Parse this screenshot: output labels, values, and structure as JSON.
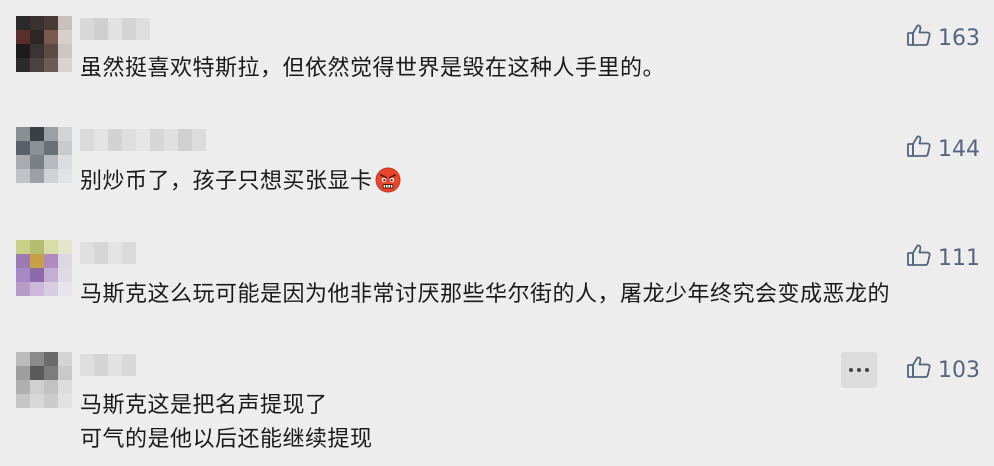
{
  "comments": [
    {
      "text_lines": [
        "虽然挺喜欢特斯拉，但依然觉得世界是毁在这种人手里的。"
      ],
      "likes": "163"
    },
    {
      "text_lines": [
        "别炒币了，孩子只想买张显卡"
      ],
      "emoji": "angry-face-icon",
      "likes": "144"
    },
    {
      "text_lines": [
        "马斯克这么玩可能是因为他非常讨厌那些华尔街的人，屠龙少年终究会变成恶龙的"
      ],
      "likes": "111"
    },
    {
      "text_lines": [
        "马斯克这是把名声提现了",
        "可气的是他以后还能继续提现"
      ],
      "likes": "103",
      "has_more_button": true
    }
  ],
  "colors": {
    "background": "#ededed",
    "like_color": "#55657e",
    "text_color": "#1a1a1a"
  }
}
